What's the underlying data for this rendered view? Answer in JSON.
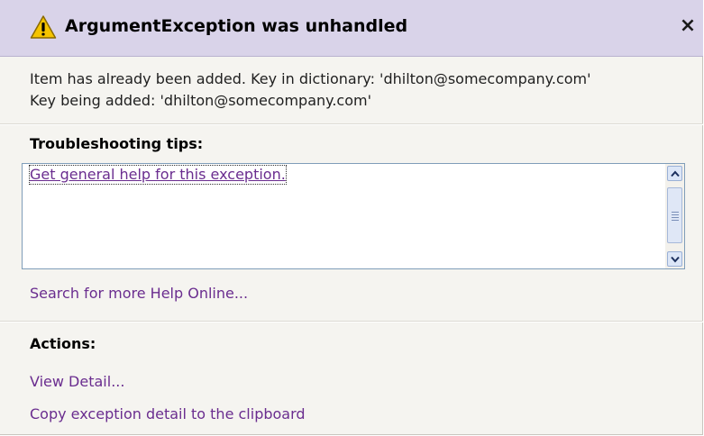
{
  "dialog": {
    "title": "ArgumentException was unhandled",
    "close_glyph": "×",
    "icon": "warning-triangle-icon",
    "message_line1": "Item has already been added. Key in dictionary: 'dhilton@somecompany.com'",
    "message_line2": "Key being added: 'dhilton@somecompany.com'"
  },
  "troubleshooting": {
    "heading": "Troubleshooting tips:",
    "tips": [
      "Get general help for this exception."
    ],
    "search_link": "Search for more Help Online..."
  },
  "actions": {
    "heading": "Actions:",
    "items": [
      "View Detail...",
      "Copy exception detail to the clipboard"
    ]
  },
  "colors": {
    "titlebar": "#d9d3e9",
    "link": "#6a2d8f",
    "body": "#f5f4f0"
  }
}
